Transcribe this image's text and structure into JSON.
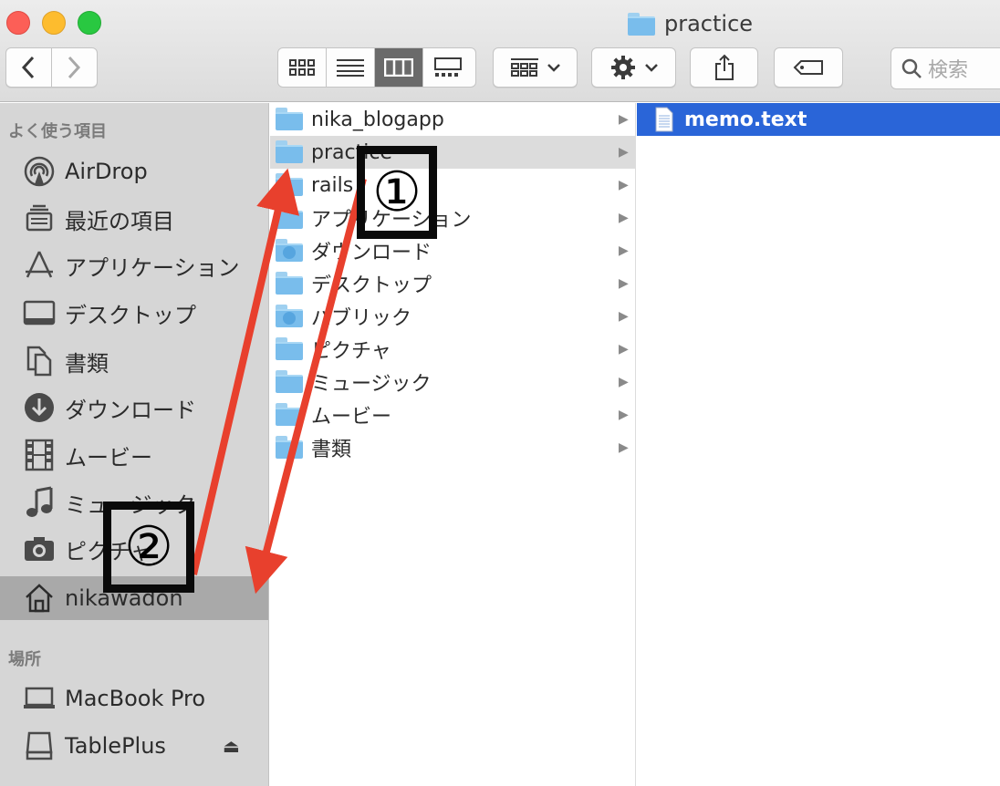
{
  "window": {
    "title": "practice"
  },
  "toolbar": {
    "back_icon": "chevron-left-icon",
    "forward_icon": "chevron-right-icon",
    "view_modes": [
      "icon-view",
      "list-view",
      "column-view",
      "gallery-view"
    ],
    "active_view": "column-view",
    "search_placeholder": "検索"
  },
  "sidebar": {
    "favorites_heading": "よく使う項目",
    "favorites": [
      {
        "label": "AirDrop",
        "icon": "airdrop-icon"
      },
      {
        "label": "最近の項目",
        "icon": "recents-icon"
      },
      {
        "label": "アプリケーション",
        "icon": "applications-icon"
      },
      {
        "label": "デスクトップ",
        "icon": "desktop-icon"
      },
      {
        "label": "書類",
        "icon": "documents-icon"
      },
      {
        "label": "ダウンロード",
        "icon": "downloads-icon"
      },
      {
        "label": "ムービー",
        "icon": "movies-icon"
      },
      {
        "label": "ミュージック",
        "icon": "music-icon"
      },
      {
        "label": "ピクチャ",
        "icon": "camera-icon"
      },
      {
        "label": "nikawadon",
        "icon": "home-icon",
        "selected": true
      }
    ],
    "locations_heading": "場所",
    "locations": [
      {
        "label": "MacBook Pro",
        "icon": "laptop-icon"
      },
      {
        "label": "TablePlus",
        "icon": "drive-icon",
        "eject": true
      }
    ],
    "eject_glyph": "⏏"
  },
  "column1": {
    "items": [
      {
        "name": "nika_blogapp"
      },
      {
        "name": "practice",
        "selected": true
      },
      {
        "name": "rails"
      },
      {
        "name": "アプリケーション"
      },
      {
        "name": "ダウンロード"
      },
      {
        "name": "デスクトップ"
      },
      {
        "name": "パブリック"
      },
      {
        "name": "ピクチャ"
      },
      {
        "name": "ミュージック"
      },
      {
        "name": "ムービー"
      },
      {
        "name": "書類"
      }
    ],
    "chevron": "▶"
  },
  "column2": {
    "items": [
      {
        "name": "memo.text",
        "selected": true
      }
    ]
  },
  "annotations": {
    "label1": "①",
    "label2": "②",
    "arrow_color": "#e8402d"
  }
}
